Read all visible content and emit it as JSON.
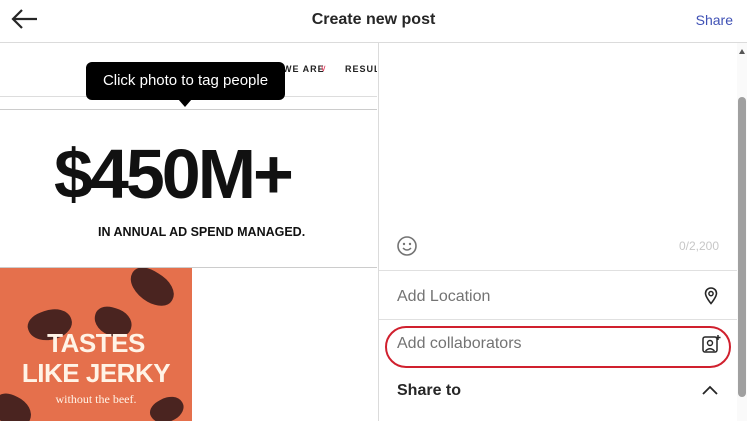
{
  "header": {
    "title": "Create new post",
    "share_label": "Share"
  },
  "photo": {
    "tooltip": "Click photo to tag people",
    "nav_we_are": "WE ARE",
    "nav_results": "RESUL",
    "headline": "$450M+",
    "subheadline": "IN ANNUAL AD SPEND MANAGED.",
    "jerky_line1": "TASTES",
    "jerky_line2": "LIKE JERKY",
    "jerky_line3": "without the beef."
  },
  "caption": {
    "char_count": "0/2,200",
    "emoji_icon": "smiley-icon"
  },
  "rows": {
    "location_label": "Add Location",
    "location_icon": "location-pin-icon",
    "collaborators_label": "Add collaborators",
    "collaborators_icon": "add-person-icon"
  },
  "share_section": {
    "label": "Share to",
    "toggle_icon": "chevron-up-icon"
  },
  "colors": {
    "accent": "#3f51b5",
    "highlight_outline": "#d0202e"
  }
}
